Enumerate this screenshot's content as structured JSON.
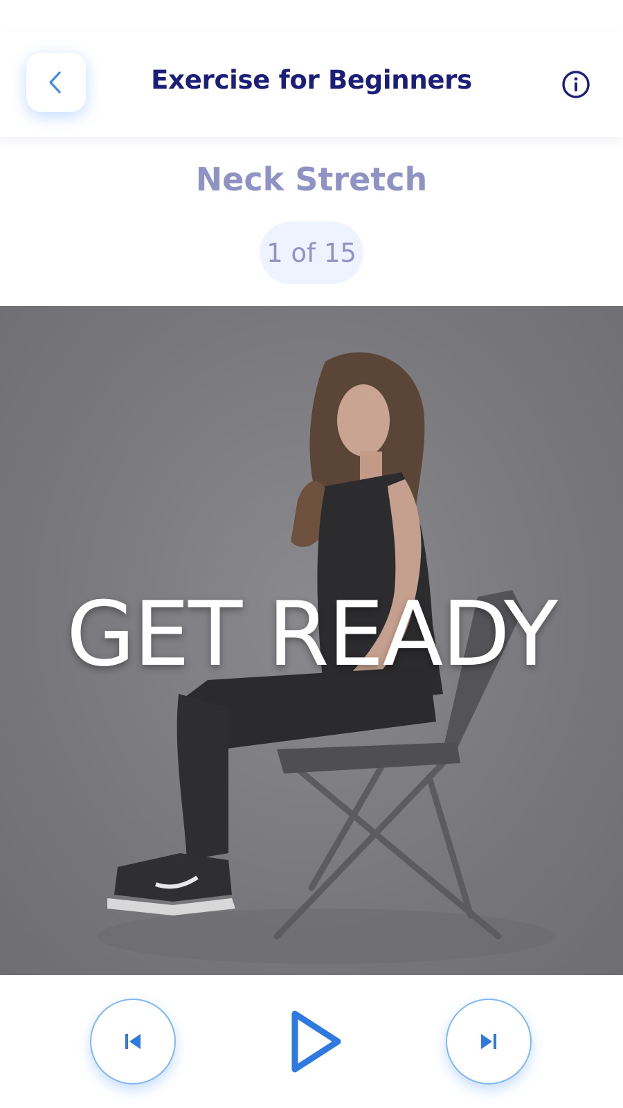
{
  "header": {
    "title": "Exercise for Beginners",
    "back_icon": "chevron-left-icon",
    "info_icon": "info-circle-icon"
  },
  "exercise": {
    "name": "Neck Stretch",
    "counter": "1 of 15"
  },
  "video": {
    "overlay_text": "GET READY",
    "image_description_icon": "woman-seated-on-folding-chair-image"
  },
  "controls": {
    "previous_icon": "skip-previous-icon",
    "play_icon": "play-icon",
    "next_icon": "skip-next-icon"
  },
  "colors": {
    "title": "#1c1f7a",
    "muted_text": "#8f93c4",
    "accent_blue": "#2f7ae0",
    "pill_bg": "#eef4ff"
  }
}
